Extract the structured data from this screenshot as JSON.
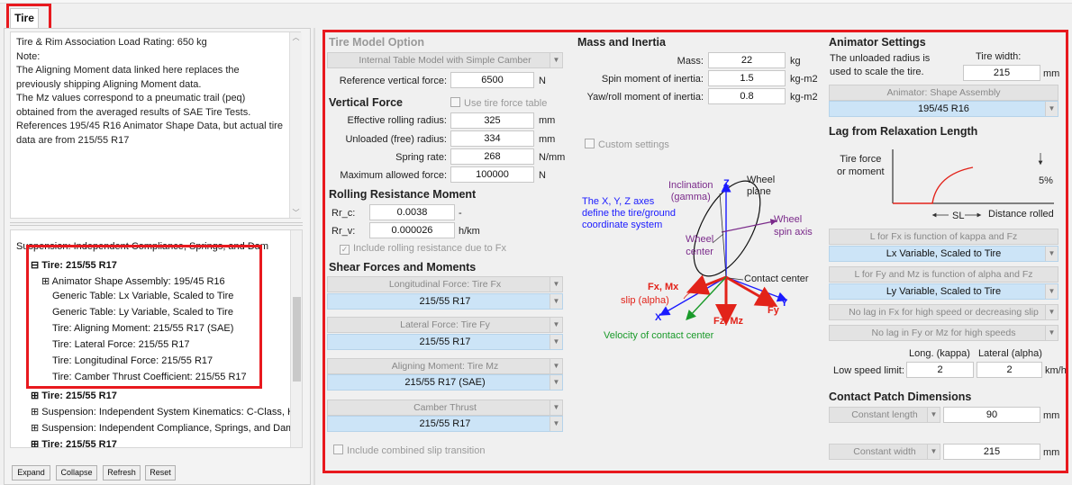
{
  "tab": {
    "label": "Tire"
  },
  "notes": {
    "lines": [
      "Tire & Rim Association Load Rating: 650 kg",
      "",
      "Note:",
      "The Aligning Moment data linked here replaces the",
      "previously shipping Aligning Moment data.",
      "",
      "The Mz values correspond to a pneumatic trail (peq)",
      "obtained from the averaged results of SAE Tire Tests.",
      "",
      "References 195/45 R16 Animator Shape Data, but actual tire",
      "data are from 215/55 R17"
    ]
  },
  "tree": {
    "top_cut": "Suspension: Independent Compliance, Springs, and Dam",
    "group1": {
      "label": "Tire: 215/55 R17",
      "children": [
        "Animator Shape Assembly: 195/45 R16",
        "Generic Table: Lx Variable, Scaled to Tire",
        "Generic Table: Ly Variable, Scaled to Tire",
        "Tire: Aligning Moment: 215/55 R17 (SAE)",
        "Tire: Lateral Force: 215/55 R17",
        "Tire: Longitudinal Force: 215/55 R17",
        "Tire: Camber Thrust Coefficient: 215/55 R17"
      ]
    },
    "after": [
      {
        "label": "Tire: 215/55 R17",
        "bold": true
      },
      {
        "label": "Suspension: Independent System Kinematics: C-Class, H",
        "bold": false
      },
      {
        "label": "Suspension: Independent Compliance, Springs, and Dam",
        "bold": false
      },
      {
        "label": "Tire: 215/55 R17",
        "bold": true
      }
    ]
  },
  "buttons": {
    "expand": "Expand",
    "collapse": "Collapse",
    "refresh": "Refresh",
    "reset": "Reset"
  },
  "tire_model": {
    "header": "Tire Model Option",
    "selected": "Internal Table Model with Simple Camber"
  },
  "vertical_force": {
    "header": "Vertical Force",
    "use_table": "Use tire force table",
    "ref_force": {
      "label": "Reference vertical force:",
      "value": "6500",
      "unit": "N"
    },
    "eff_radius": {
      "label": "Effective rolling radius:",
      "value": "325",
      "unit": "mm"
    },
    "unloaded_radius": {
      "label": "Unloaded (free) radius:",
      "value": "334",
      "unit": "mm"
    },
    "spring_rate": {
      "label": "Spring rate:",
      "value": "268",
      "unit": "N/mm"
    },
    "max_force": {
      "label": "Maximum allowed force:",
      "value": "100000",
      "unit": "N"
    }
  },
  "rolling_resistance": {
    "header": "Rolling Resistance Moment",
    "rr_c": {
      "label": "Rr_c:",
      "value": "0.0038",
      "unit": "-"
    },
    "rr_v": {
      "label": "Rr_v:",
      "value": "0.000026",
      "unit": "h/km"
    },
    "include_due_fx": "Include rolling resistance due to Fx"
  },
  "shear_forces": {
    "header": "Shear Forces and Moments",
    "items": [
      {
        "name": "Longitudinal Force: Tire Fx",
        "value": "215/55 R17"
      },
      {
        "name": "Lateral Force: Tire Fy",
        "value": "215/55 R17"
      },
      {
        "name": "Aligning Moment: Tire Mz",
        "value": "215/55 R17 (SAE)"
      },
      {
        "name": "Camber Thrust",
        "value": "215/55 R17"
      }
    ],
    "combined_slip": "Include combined slip transition"
  },
  "mass_inertia": {
    "header": "Mass and Inertia",
    "mass": {
      "label": "Mass:",
      "value": "22",
      "unit": "kg"
    },
    "spin": {
      "label": "Spin moment of inertia:",
      "value": "1.5",
      "unit": "kg-m2"
    },
    "yaw": {
      "label": "Yaw/roll moment of inertia:",
      "value": "0.8",
      "unit": "kg-m2"
    },
    "custom": "Custom settings"
  },
  "diagram": {
    "caption": [
      "The X, Y, Z axes",
      "define the tire/ground",
      "coordinate system"
    ],
    "inclination": [
      "Inclination",
      "(gamma)"
    ],
    "z": "Z",
    "wheel_plane": [
      "Wheel",
      "plane"
    ],
    "wheel_spin": [
      "Wheel",
      "spin axis"
    ],
    "wheel_center": [
      "Wheel",
      "center"
    ],
    "contact_center": "Contact center",
    "fx_mx": "Fx, Mx",
    "slip": "slip (alpha)",
    "x": "X",
    "fz_mz": "Fz, Mz",
    "fy": "Fy",
    "y": "Y",
    "velocity": "Velocity of contact center",
    "colors": {
      "blue": "#1a1aff",
      "red": "#e2231a",
      "green": "#1a9a2a",
      "purple": "#7a2a8a"
    }
  },
  "animator": {
    "header": "Animator Settings",
    "note": [
      "The unloaded radius is",
      "used to scale the tire."
    ],
    "tire_width": {
      "label": "Tire width:",
      "value": "215",
      "unit": "mm"
    },
    "shape_name": "Animator: Shape Assembly",
    "shape_value": "195/45 R16"
  },
  "lag": {
    "header": "Lag from Relaxation Length",
    "tire_force": [
      "Tire force",
      "or moment"
    ],
    "five": "5%",
    "sl": "SL",
    "dist": "Distance rolled",
    "items": [
      {
        "name": "L for Fx is function of kappa and Fz",
        "value": "Lx Variable, Scaled to Tire"
      },
      {
        "name": "L for Fy and Mz is function of alpha and Fz",
        "value": "Ly Variable, Scaled to Tire"
      }
    ],
    "no_lag_fx": "No lag in Fx for high speed or decreasing slip",
    "no_lag_fy": "No lag in Fy or Mz for high speeds",
    "long_label": "Long. (kappa)",
    "lat_label": "Lateral (alpha)",
    "low_speed": {
      "label": "Low speed limit:",
      "long": "2",
      "lat": "2",
      "unit": "km/h"
    }
  },
  "contact_patch": {
    "header": "Contact Patch Dimensions",
    "length": {
      "label": "Constant length",
      "value": "90",
      "unit": "mm"
    },
    "width": {
      "label": "Constant width",
      "value": "215",
      "unit": "mm"
    }
  }
}
